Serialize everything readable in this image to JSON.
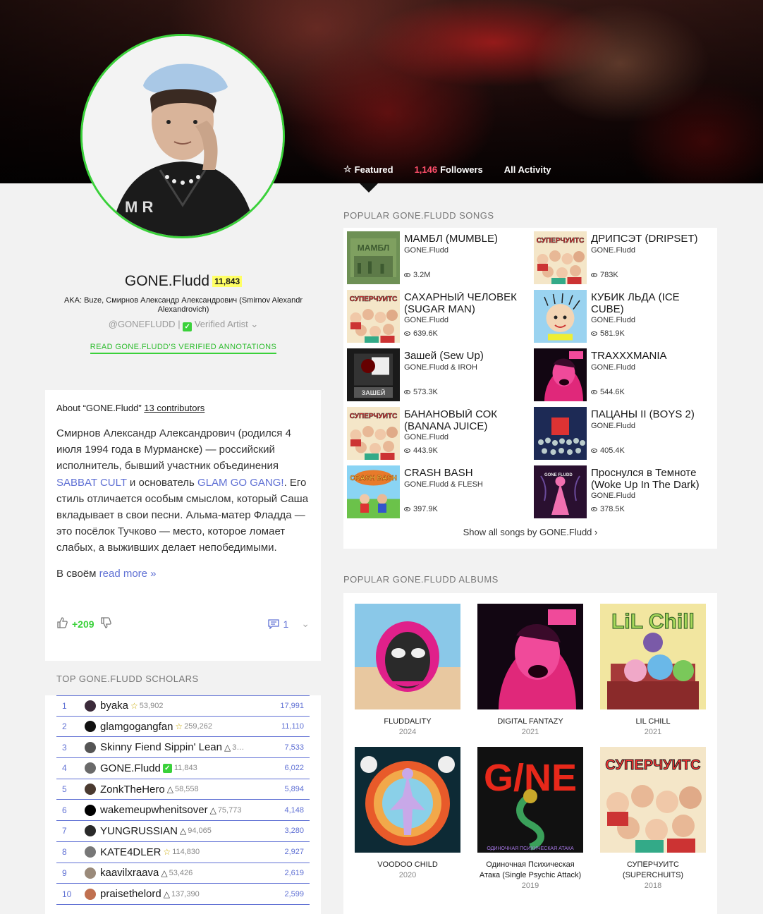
{
  "header": {
    "tabs": [
      {
        "label": "Featured",
        "icon": "star-outline-icon"
      },
      {
        "count": "1,146",
        "label": "Followers"
      },
      {
        "label": "All Activity"
      }
    ]
  },
  "artist": {
    "name": "GONE.Fludd",
    "iq": "11,843",
    "aka": "AKA: Buze, Смирнов Александр Александрович (Smirnov Alexandr Alexandrovich)",
    "handle": "@GONEFLUDD",
    "separator": "|",
    "verified": "Verified Artist",
    "annotations_link": "READ GONE.FLUDD'S VERIFIED ANNOTATIONS"
  },
  "about": {
    "head_prefix": "About “GONE.Fludd”",
    "contributors": "13 contributors",
    "text_1": "Смирнов Александр Александрович (родился 4 июля 1994 года в Мурманске) — российский исполнитель, бывший участник объединения ",
    "link_1": "SABBAT CULT",
    "text_2": " и основатель ",
    "link_2": "GLAM GO GANG!",
    "text_3": ". Его стиль отличается особым смыслом, который Саша вкладывает в свои песни. Альма-матер Фладда — это посёлок Тучково — место, которое ломает слабых, а выживших делает непобедимыми.",
    "more_prefix": "В своём ",
    "more_link": "read more »",
    "votes": "+209",
    "comments": "1"
  },
  "scholars": {
    "title": "TOP GONE.FLUDD SCHOLARS",
    "rows": [
      {
        "rank": "1",
        "name": "byaka",
        "role": "☆",
        "iq": "53,902",
        "score": "17,991",
        "avatar": "#3b2a3a"
      },
      {
        "rank": "2",
        "name": "glamgogangfan",
        "role": "☆",
        "iq": "259,262",
        "score": "11,110",
        "avatar": "#111111"
      },
      {
        "rank": "3",
        "name": "Skinny Fiend Sippin' Lean",
        "role": "△",
        "iq": "3…",
        "score": "7,533",
        "avatar": "#555555"
      },
      {
        "rank": "4",
        "name": "GONE.Fludd",
        "role": "✓",
        "iq": "11,843",
        "score": "6,022",
        "avatar": "#6a6a6a"
      },
      {
        "rank": "5",
        "name": "ZonkTheHero",
        "role": "△",
        "iq": "58,558",
        "score": "5,894",
        "avatar": "#4a3a30"
      },
      {
        "rank": "6",
        "name": "wakemeupwhenitsover",
        "role": "△",
        "iq": "75,773",
        "score": "4,148",
        "avatar": "#000000"
      },
      {
        "rank": "7",
        "name": "YUNGRUSSIAN",
        "role": "△",
        "iq": "94,065",
        "score": "3,280",
        "avatar": "#2a2a2a"
      },
      {
        "rank": "8",
        "name": "KATE4DLER",
        "role": "☆",
        "iq": "114,830",
        "score": "2,927",
        "avatar": "#777777"
      },
      {
        "rank": "9",
        "name": "kaavilxraava",
        "role": "△",
        "iq": "53,426",
        "score": "2,619",
        "avatar": "#9a8a7a"
      },
      {
        "rank": "10",
        "name": "praisethelord",
        "role": "△",
        "iq": "137,390",
        "score": "2,599",
        "avatar": "#c07050"
      }
    ]
  },
  "songs": {
    "title": "POPULAR GONE.FLUDD SONGS",
    "items": [
      {
        "title": "МАМБЛ (MUMBLE)",
        "artist": "GONE.Fludd",
        "views": "3.2M",
        "art": "mumble"
      },
      {
        "title": "ДРИПСЭТ (DRIPSET)",
        "artist": "GONE.Fludd",
        "views": "783K",
        "art": "superchuits"
      },
      {
        "title": "САХАРНЫЙ ЧЕЛОВЕК (SUGAR MAN)",
        "artist": "GONE.Fludd",
        "views": "639.6K",
        "art": "superchuits"
      },
      {
        "title": "КУБИК ЛЬДА (ICE CUBE)",
        "artist": "GONE.Fludd",
        "views": "581.9K",
        "art": "icecube"
      },
      {
        "title": "Зашей (Sew Up)",
        "artist": "GONE.Fludd & IROH",
        "views": "573.3K",
        "art": "sewup"
      },
      {
        "title": "TRAXXXMANIA",
        "artist": "GONE.Fludd",
        "views": "544.6K",
        "art": "digital"
      },
      {
        "title": "БАНАНОВЫЙ СОК (BANANA JUICE)",
        "artist": "GONE.Fludd",
        "views": "443.9K",
        "art": "superchuits"
      },
      {
        "title": "ПАЦАНЫ II (BOYS 2)",
        "artist": "GONE.Fludd",
        "views": "405.4K",
        "art": "boys"
      },
      {
        "title": "CRASH BASH",
        "artist": "GONE.Fludd & FLESH",
        "views": "397.9K",
        "art": "crash"
      },
      {
        "title": "Проснулся в Темноте (Woke Up In The Dark)",
        "artist": "GONE.Fludd",
        "views": "378.5K",
        "art": "woke"
      }
    ],
    "show_all": "Show all songs by GONE.Fludd"
  },
  "albums": {
    "title": "POPULAR GONE.FLUDD ALBUMS",
    "items": [
      {
        "title": "FLUDDALITY",
        "year": "2024",
        "art": "fluddality"
      },
      {
        "title": "DIGITAL FANTAZY",
        "year": "2021",
        "art": "digital"
      },
      {
        "title": "LIL CHILL",
        "year": "2021",
        "art": "lilchill"
      },
      {
        "title": "VOODOO CHILD",
        "year": "2020",
        "art": "voodoo"
      },
      {
        "title": "Одиночная Психическая Атака (Single Psychic Attack)",
        "year": "2019",
        "art": "gone"
      },
      {
        "title": "СУПЕРЧУИТС (SUPERCHUITS)",
        "year": "2018",
        "art": "superchuits"
      }
    ]
  },
  "art_text": {
    "mumble": "МАМБЛ",
    "superchuits": "СУПЕРЧУИТС",
    "lilchill": "LiL Chill",
    "gone": "G/NE",
    "gone_caption": "ОДИНОЧНАЯ ПСИХИЧЕСКАЯ АТАКА",
    "crash": "CRASH BASH",
    "woke": "GONE FLUDD"
  }
}
